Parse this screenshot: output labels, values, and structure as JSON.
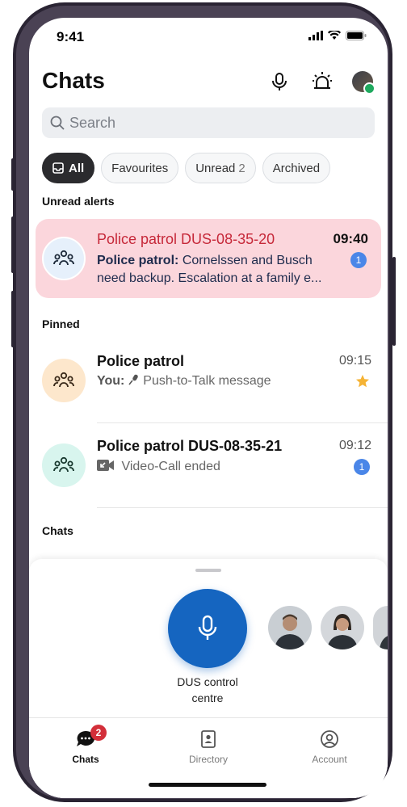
{
  "status_bar": {
    "time": "9:41"
  },
  "header": {
    "title": "Chats"
  },
  "search": {
    "placeholder": "Search"
  },
  "filters": [
    {
      "label": "All"
    },
    {
      "label": "Favourites"
    },
    {
      "label": "Unread",
      "count": "2"
    },
    {
      "label": "Archived"
    }
  ],
  "sections": {
    "unread_alerts": "Unread alerts",
    "pinned": "Pinned",
    "chats": "Chats"
  },
  "alert": {
    "title": "Police patrol DUS-08-35-20",
    "time": "09:40",
    "sender": "Police patrol:",
    "message_line1": "Cornelssen and Busch",
    "message_line2": "need backup. Escalation at a family e...",
    "unread": "1"
  },
  "pinned": [
    {
      "title": "Police patrol",
      "time": "09:15",
      "sender": "You:",
      "message": "Push-to-Talk message",
      "marker": "star-icon"
    },
    {
      "title": "Police patrol DUS-08-35-21",
      "time": "09:12",
      "message": "Video-Call ended",
      "unread": "1"
    }
  ],
  "ptt": {
    "label_line1": "DUS control",
    "label_line2": "centre"
  },
  "tabs": [
    {
      "label": "Chats",
      "badge": "2"
    },
    {
      "label": "Directory"
    },
    {
      "label": "Account"
    }
  ],
  "colors": {
    "accent": "#1565c0",
    "alert_bg": "#fbd6dc",
    "alert_title": "#c62839",
    "badge_blue": "#4a86e8",
    "badge_red": "#d32f3a",
    "star": "#f5b335"
  }
}
